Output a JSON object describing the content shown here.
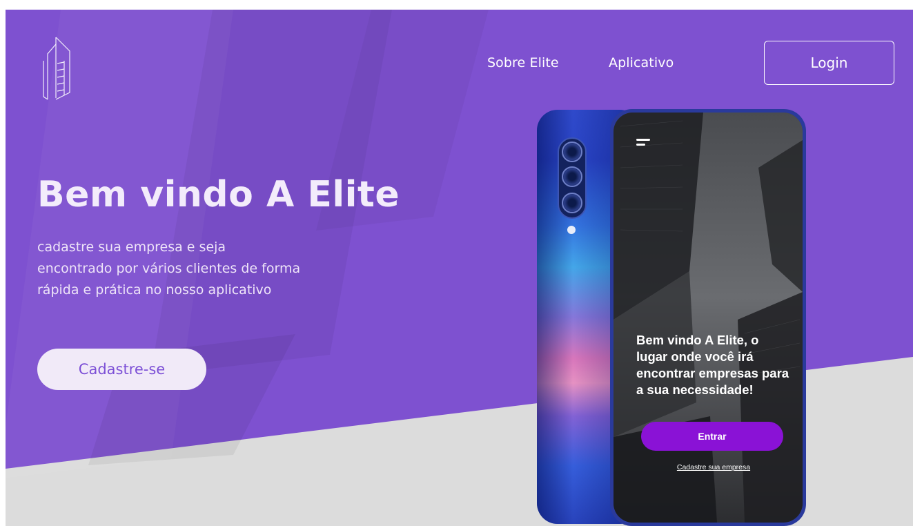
{
  "colors": {
    "primary_purple": "#7e51d0",
    "light_gray": "#dcdcdc",
    "button_purple": "#8a12d6",
    "hero_text": "#f3ecfb"
  },
  "header": {
    "logo_icon": "building-logo-icon",
    "nav": [
      {
        "label": "Sobre Elite"
      },
      {
        "label": "Aplicativo"
      }
    ],
    "login_label": "Login"
  },
  "hero": {
    "title": "Bem vindo A Elite",
    "subtitle_lines": [
      "cadastre sua empresa e seja",
      "encontrado por vários clientes de forma",
      "rápida e prática no nosso aplicativo"
    ],
    "cta_label": "Cadastre-se"
  },
  "phone": {
    "menu_icon": "hamburger-menu-icon",
    "headline_lines": [
      "Bem vindo A Elite, o",
      "lugar onde você irá",
      "encontrar empresas para",
      "a sua necessidade!"
    ],
    "enter_label": "Entrar",
    "register_link": "Cadastre sua empresa"
  }
}
